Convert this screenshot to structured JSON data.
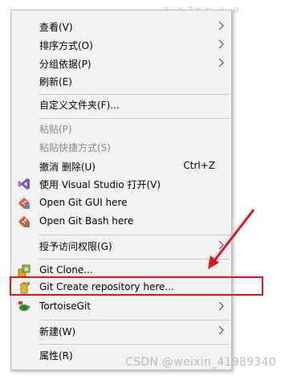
{
  "background": {
    "text": "ㄹ ㄹ 1ㄷㄷ ㅅ ㄹ"
  },
  "menu": {
    "items": [
      {
        "label": "查看(V)",
        "submenu": true
      },
      {
        "label": "排序方式(O)",
        "submenu": true
      },
      {
        "label": "分组依据(P)",
        "submenu": true
      },
      {
        "label": "刷新(E)"
      },
      {
        "label": "自定义文件夹(F)..."
      },
      {
        "label": "粘贴(P)",
        "disabled": true
      },
      {
        "label": "粘贴快捷方式(S)",
        "disabled": true
      },
      {
        "label": "撤消 删除(U)",
        "shortcut": "Ctrl+Z"
      },
      {
        "label": "使用 Visual Studio 打开(V)",
        "icon": "visual-studio-icon"
      },
      {
        "label": "Open Git GUI here",
        "icon": "git-gui-icon"
      },
      {
        "label": "Open Git Bash here",
        "icon": "git-bash-icon"
      },
      {
        "label": "授予访问权限(G)",
        "submenu": true
      },
      {
        "label": "Git Clone...",
        "icon": "git-clone-icon"
      },
      {
        "label": "Git Create repository here...",
        "icon": "git-create-repo-icon"
      },
      {
        "label": "TortoiseGit",
        "icon": "tortoisegit-icon",
        "submenu": true
      },
      {
        "label": "新建(W)",
        "submenu": true
      },
      {
        "label": "属性(R)"
      }
    ]
  },
  "annotation": {
    "highlighted_item": "Git Create repository here...",
    "highlight_color": "#e1141b"
  },
  "watermark": "CSDN @weixin_41989340"
}
